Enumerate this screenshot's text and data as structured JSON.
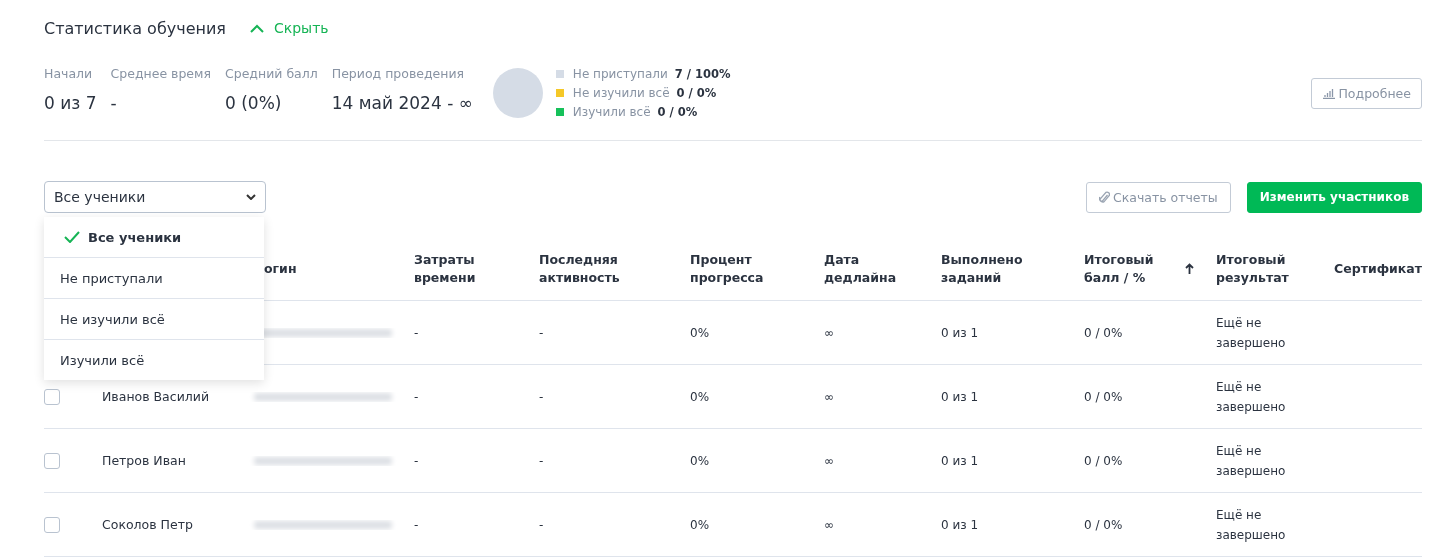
{
  "header": {
    "title": "Статистика обучения",
    "toggle": {
      "label": "Скрыть",
      "expanded": true
    }
  },
  "stats": [
    {
      "label": "Начали",
      "value": "0 из 7"
    },
    {
      "label": "Среднее время",
      "value": "-"
    },
    {
      "label": "Средний балл",
      "value": "0 (0%)"
    },
    {
      "label": "Период проведения",
      "value": "14 май 2024 - ∞"
    }
  ],
  "legend": [
    {
      "label": "Не приступали",
      "count": "7 / 100%",
      "color": "#d5dce6"
    },
    {
      "label": "Не изучили всё",
      "count": "0 / 0%",
      "color": "#f5c828"
    },
    {
      "label": "Изучили всё",
      "count": "0 / 0%",
      "color": "#16c15a"
    }
  ],
  "details_button": "Подробнее",
  "filter": {
    "value": "Все ученики",
    "options": [
      {
        "label": "Все ученики",
        "selected": true
      },
      {
        "label": "Не приступали",
        "selected": false
      },
      {
        "label": "Не изучили всё",
        "selected": false
      },
      {
        "label": "Изучили всё",
        "selected": false
      }
    ]
  },
  "actions": [
    {
      "label": "Скачать отчеты",
      "kind": "secondary"
    },
    {
      "label": "Изменить участников",
      "kind": "primary"
    }
  ],
  "table": {
    "columns": [
      {
        "label": "огин"
      },
      {
        "label": "Затраты времени"
      },
      {
        "label": "Последняя активность"
      },
      {
        "label": "Процент прогресса"
      },
      {
        "label": "Дата дедлайна"
      },
      {
        "label": "Выполнено заданий"
      },
      {
        "label": "Итоговый балл / %",
        "sorted": true
      },
      {
        "label": "Итоговый результат"
      },
      {
        "label": "Сертификат"
      }
    ],
    "rows": [
      {
        "time": "-",
        "activity": "-",
        "progress": "0%",
        "deadline": "∞",
        "done": "0 из 1",
        "score": "0 / 0%",
        "result": "Ещё не завершено"
      },
      {
        "checked": false,
        "name": "Иванов Василий",
        "time": "-",
        "activity": "-",
        "progress": "0%",
        "deadline": "∞",
        "done": "0 из 1",
        "score": "0 / 0%",
        "result": "Ещё не завершено"
      },
      {
        "checked": false,
        "name": "Петров Иван",
        "time": "-",
        "activity": "-",
        "progress": "0%",
        "deadline": "∞",
        "done": "0 из 1",
        "score": "0 / 0%",
        "result": "Ещё не завершено"
      },
      {
        "checked": false,
        "name": "Соколов Петр",
        "time": "-",
        "activity": "-",
        "progress": "0%",
        "deadline": "∞",
        "done": "0 из 1",
        "score": "0 / 0%",
        "result": "Ещё не завершено"
      }
    ]
  }
}
